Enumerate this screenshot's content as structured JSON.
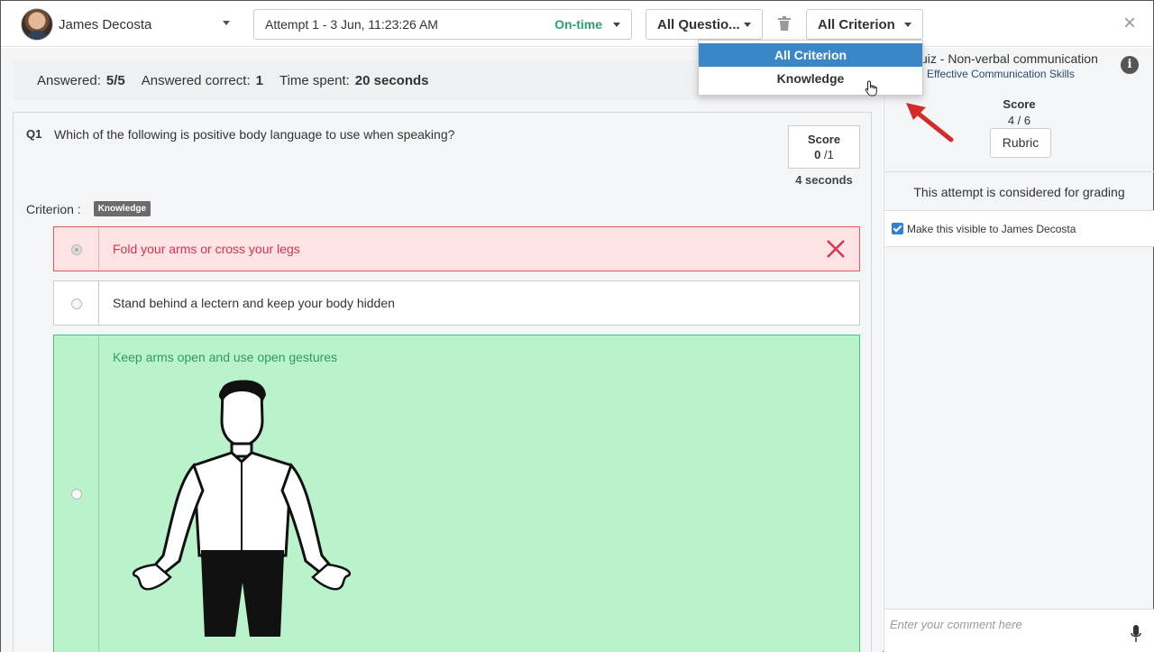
{
  "topbar": {
    "user_name": "James Decosta",
    "attempt_label": "Attempt 1 - 3 Jun, 11:23:26 AM",
    "attempt_status": "On-time",
    "questions_filter": "All Questio...",
    "criterion_filter": "All Criterion"
  },
  "dropdown": {
    "items": [
      {
        "label": "All Criterion"
      },
      {
        "label": "Knowledge"
      }
    ]
  },
  "summary": {
    "answered_label": "Answered:",
    "answered_value": "5/5",
    "correct_label": "Answered correct:",
    "correct_value": "1",
    "time_label": "Time spent:",
    "time_value": "20 seconds"
  },
  "question": {
    "number": "Q1",
    "text": "Which of the following is positive body language to use when speaking?",
    "score_title": "Score",
    "score_value": "0",
    "score_total": "/1",
    "time": "4 seconds",
    "criterion_label": "Criterion :",
    "criterion_badge": "Knowledge",
    "options": [
      {
        "text": "Fold your arms or cross your legs"
      },
      {
        "text": "Stand behind a lectern and keep your body hidden"
      },
      {
        "text": "Keep arms open and use open gestures"
      }
    ]
  },
  "right_panel": {
    "quiz_title": "uiz - Non-verbal communication",
    "quiz_subtitle": "Effective Communication Skills",
    "score_title": "Score",
    "score_value": "4 / 6",
    "rubric_label": "Rubric",
    "grading_text": "This attempt is considered for grading",
    "visible_text": "Make this visible to James Decosta",
    "comment_placeholder": "Enter your comment here"
  },
  "colors": {
    "accent": "#3a87c8",
    "correct_bg": "#baf2cc",
    "wrong_bg": "#fde3e3",
    "status_green": "#2aa36b",
    "arrow_red": "#d42a2a"
  }
}
